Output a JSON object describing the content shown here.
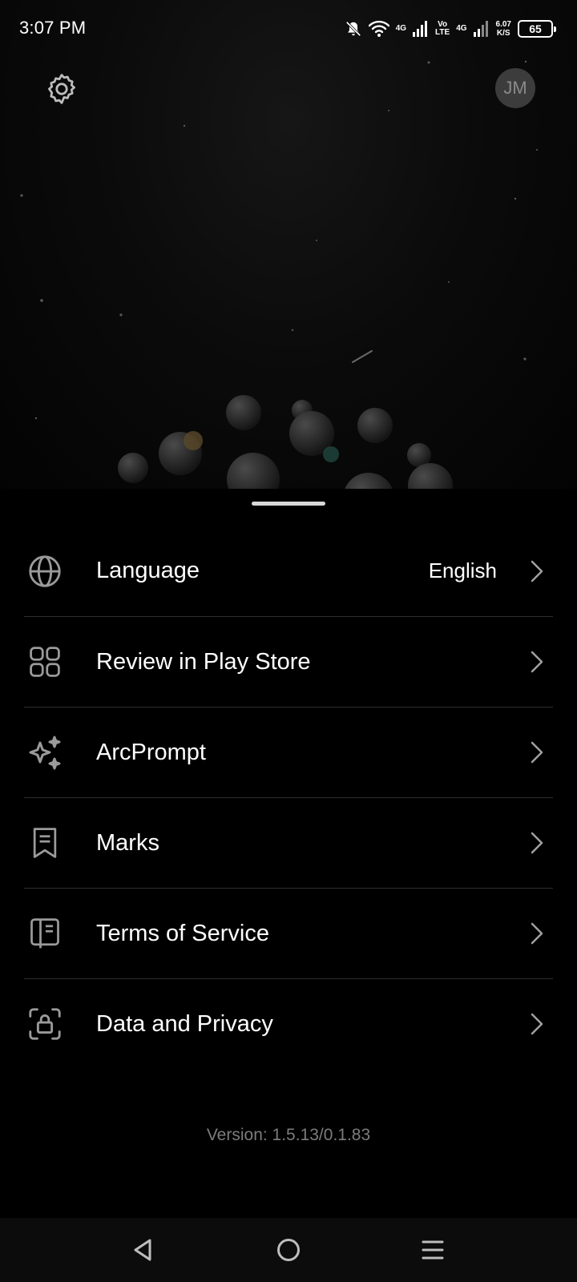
{
  "status_bar": {
    "time": "3:07 PM",
    "net1": "4G",
    "volte_top": "Vo",
    "volte_bottom": "LTE",
    "net2": "4G",
    "speed_value": "6.07",
    "speed_unit": "K/S",
    "battery": "65",
    "icons": [
      "bell-off-icon",
      "wifi-icon",
      "signal-icon",
      "signal-icon",
      "battery-icon"
    ]
  },
  "header": {
    "settings_icon": "gear-icon",
    "avatar_initials": "JM"
  },
  "menu": {
    "items": [
      {
        "label": "Language",
        "value": "English",
        "icon": "globe-icon"
      },
      {
        "label": "Review in Play Store",
        "icon": "grid-icon"
      },
      {
        "label": "ArcPrompt",
        "icon": "sparkles-icon"
      },
      {
        "label": "Marks",
        "icon": "bookmark-icon"
      },
      {
        "label": "Terms of Service",
        "icon": "book-icon"
      },
      {
        "label": "Data and Privacy",
        "icon": "lock-scan-icon"
      }
    ]
  },
  "footer": {
    "version": "Version: 1.5.13/0.1.83"
  },
  "nav_bar": {
    "back_icon": "back-triangle-icon",
    "home_icon": "home-circle-icon",
    "menu_icon": "menu-lines-icon"
  },
  "colors": {
    "background": "#000000",
    "text": "#ffffff",
    "muted_text": "#7c7c7c",
    "divider": "#2e2e2e",
    "avatar_bg": "#3c3c3c"
  }
}
